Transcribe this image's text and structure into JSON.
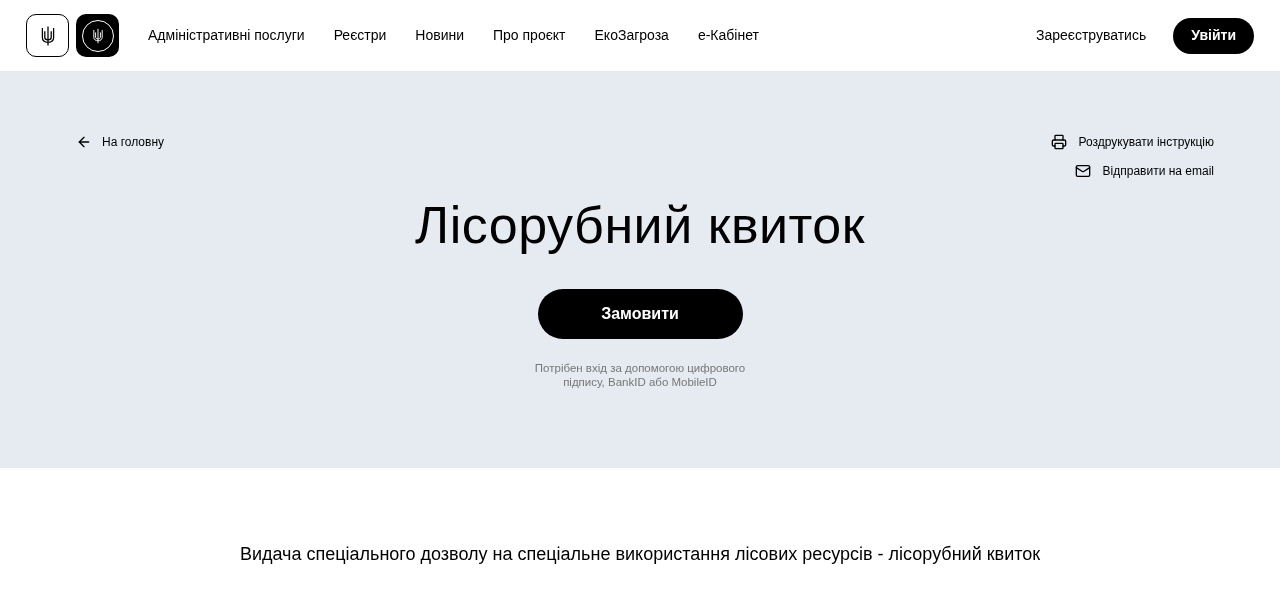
{
  "header": {
    "nav": [
      "Адміністративні послуги",
      "Реєстри",
      "Новини",
      "Про проєкт",
      "ЕкоЗагроза",
      "е-Кабінет"
    ],
    "register": "Зареєструватись",
    "login": "Увійти"
  },
  "hero": {
    "back": "На головну",
    "actions": [
      {
        "kind": "print",
        "label": "Роздрукувати інструкцію"
      },
      {
        "kind": "email",
        "label": "Відправити на email"
      }
    ],
    "title": "Лісорубний квиток",
    "order": "Замовити",
    "note": "Потрібен вхід за допомогою цифрового підпису, BankID або MobileID"
  },
  "description": "Видача спеціального дозволу на спеціальне використання лісових ресурсів - лісорубний квиток"
}
